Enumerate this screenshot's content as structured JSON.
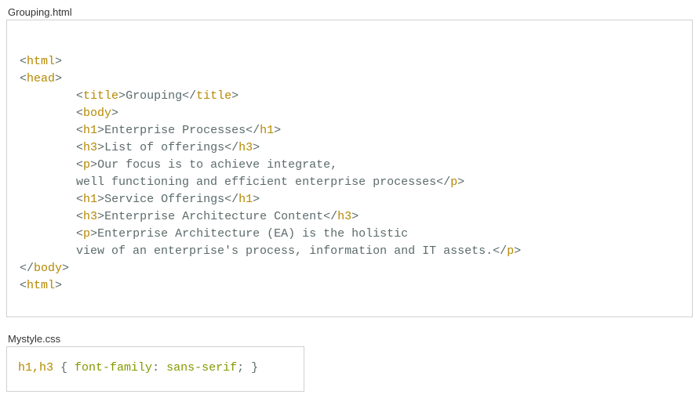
{
  "file1": {
    "name": "Grouping.html",
    "code": {
      "l1": {
        "t1": "html"
      },
      "l2": {
        "t1": "head"
      },
      "l3": {
        "t1": "title",
        "txt": "Grouping",
        "t2": "title"
      },
      "l4": {
        "t1": "body"
      },
      "l5": {
        "t1": "h1",
        "txt": "Enterprise Processes",
        "t2": "h1"
      },
      "l6": {
        "t1": "h3",
        "txt": "List of offerings",
        "t2": "h3"
      },
      "l7": {
        "t1": "p",
        "txt": "Our focus is to achieve integrate,"
      },
      "l8": {
        "txt": "well functioning and efficient enterprise processes",
        "t2": "p"
      },
      "l9": {
        "t1": "h1",
        "txt": "Service Offerings",
        "t2": "h1"
      },
      "l10": {
        "t1": "h3",
        "txt": "Enterprise Architecture Content",
        "t2": "h3"
      },
      "l11": {
        "t1": "p",
        "txt": "Enterprise Architecture (EA) is the holistic"
      },
      "l12": {
        "txt": "view of an enterprise's process, information and IT assets.",
        "t2": "p"
      },
      "l13": {
        "t1": "body"
      },
      "l14": {
        "t1": "html"
      }
    }
  },
  "file2": {
    "name": "Mystyle.css",
    "code": {
      "sel": "h1,h3",
      "prop": "font-family",
      "val": "sans-serif"
    }
  }
}
